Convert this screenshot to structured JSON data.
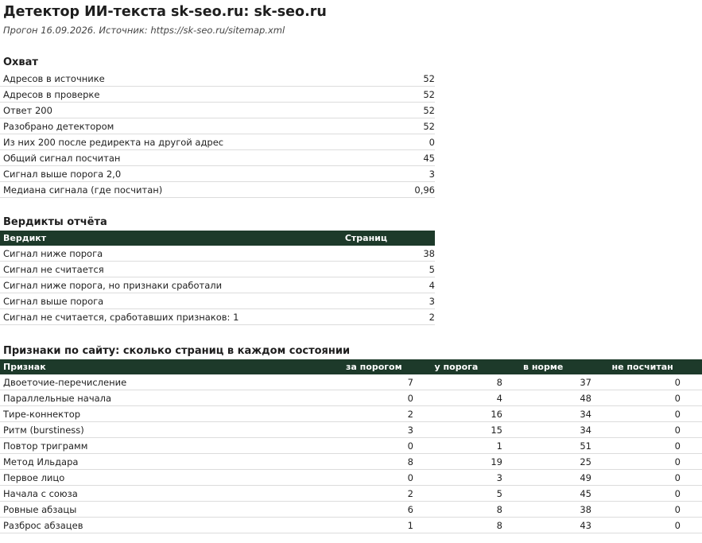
{
  "header": {
    "title": "Детектор ИИ-текста sk-seo.ru: sk-seo.ru",
    "subtitle": "Прогон 16.09.2026. Источник: https://sk-seo.ru/sitemap.xml"
  },
  "coverage": {
    "title": "Охват",
    "rows": [
      {
        "label": "Адресов в источнике",
        "value": "52"
      },
      {
        "label": "Адресов в проверке",
        "value": "52"
      },
      {
        "label": "Ответ 200",
        "value": "52"
      },
      {
        "label": "Разобрано детектором",
        "value": "52"
      },
      {
        "label": "Из них 200 после редиректа на другой адрес",
        "value": "0"
      },
      {
        "label": "Общий сигнал посчитан",
        "value": "45"
      },
      {
        "label": "Сигнал выше порога 2,0",
        "value": "3"
      },
      {
        "label": "Медиана сигнала (где посчитан)",
        "value": "0,96"
      }
    ]
  },
  "verdicts": {
    "title": "Вердикты отчёта",
    "columns": [
      "Вердикт",
      "Страниц"
    ],
    "rows": [
      {
        "label": "Сигнал ниже порога",
        "value": "38"
      },
      {
        "label": "Сигнал не считается",
        "value": "5"
      },
      {
        "label": "Сигнал ниже порога, но признаки сработали",
        "value": "4"
      },
      {
        "label": "Сигнал выше порога",
        "value": "3"
      },
      {
        "label": "Сигнал не считается, сработавших признаков: 1",
        "value": "2"
      }
    ]
  },
  "features": {
    "title": "Признаки по сайту: сколько страниц в каждом состоянии",
    "columns": [
      "Признак",
      "за порогом",
      "у порога",
      "в норме",
      "не посчитан"
    ],
    "rows": [
      {
        "label": "Двоеточие-перечисление",
        "v": [
          "7",
          "8",
          "37",
          "0"
        ]
      },
      {
        "label": "Параллельные начала",
        "v": [
          "0",
          "4",
          "48",
          "0"
        ]
      },
      {
        "label": "Тире-коннектор",
        "v": [
          "2",
          "16",
          "34",
          "0"
        ]
      },
      {
        "label": "Ритм (burstiness)",
        "v": [
          "3",
          "15",
          "34",
          "0"
        ]
      },
      {
        "label": "Повтор триграмм",
        "v": [
          "0",
          "1",
          "51",
          "0"
        ]
      },
      {
        "label": "Метод Ильдара",
        "v": [
          "8",
          "19",
          "25",
          "0"
        ]
      },
      {
        "label": "Первое лицо",
        "v": [
          "0",
          "3",
          "49",
          "0"
        ]
      },
      {
        "label": "Начала с союза",
        "v": [
          "2",
          "5",
          "45",
          "0"
        ]
      },
      {
        "label": "Ровные абзацы",
        "v": [
          "6",
          "8",
          "38",
          "0"
        ]
      },
      {
        "label": "Разброс абзацев",
        "v": [
          "1",
          "8",
          "43",
          "0"
        ]
      }
    ]
  }
}
